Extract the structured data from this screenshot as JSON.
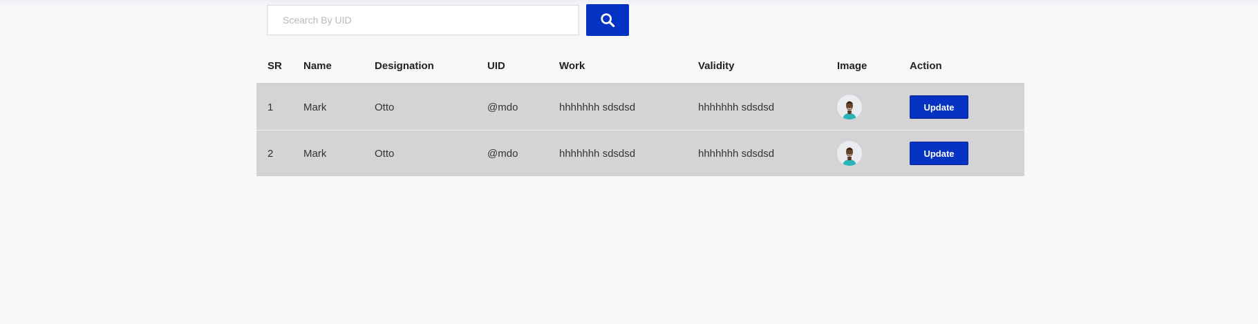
{
  "search": {
    "placeholder": "Scearch By UID",
    "value": "",
    "button_icon": "search-icon"
  },
  "table": {
    "headers": [
      "SR",
      "Name",
      "Designation",
      "UID",
      "Work",
      "Validity",
      "Image",
      "Action"
    ],
    "rows": [
      {
        "sr": "1",
        "name": "Mark",
        "designation": "Otto",
        "uid": "@mdo",
        "work": "hhhhhhh sdsdsd",
        "validity": "hhhhhhh sdsdsd",
        "image": "avatar-icon",
        "action": "Update"
      },
      {
        "sr": "2",
        "name": "Mark",
        "designation": "Otto",
        "uid": "@mdo",
        "work": "hhhhhhh sdsdsd",
        "validity": "hhhhhhh sdsdsd",
        "image": "avatar-icon",
        "action": "Update"
      }
    ]
  },
  "colors": {
    "accent": "#0433c4",
    "background": "#f7f8fa",
    "row_background": "#d4d4d6"
  }
}
